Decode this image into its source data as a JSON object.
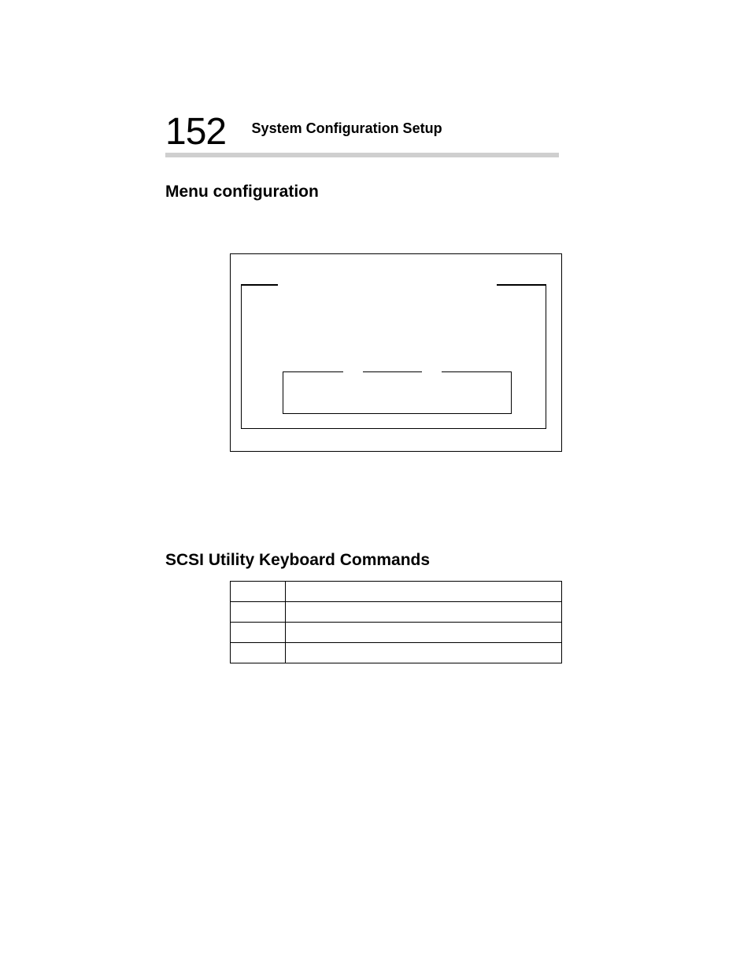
{
  "header": {
    "page_number": "152",
    "chapter_title": "System Configuration Setup"
  },
  "sections": {
    "menu_configuration": {
      "title": "Menu configuration"
    },
    "scsi_utility": {
      "title": "SCSI Utility Keyboard Commands"
    }
  },
  "key_table": {
    "rows": [
      {
        "key": "",
        "description": ""
      },
      {
        "key": "",
        "description": ""
      },
      {
        "key": "",
        "description": ""
      },
      {
        "key": "",
        "description": ""
      }
    ]
  }
}
